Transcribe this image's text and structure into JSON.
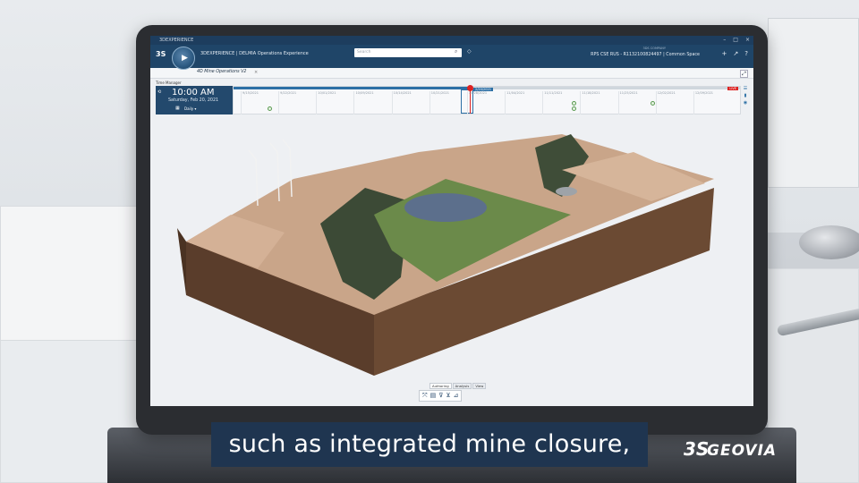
{
  "app": {
    "window_title": "3DEXPERIENCE",
    "brand_title": "3DEXPERIENCE | DELMIA Operations Experience",
    "search_placeholder": "Search",
    "user_caption": "3DS COMPANY",
    "user_context": "RPS  CSE RUS - R1132100824497 | Common Space",
    "tab_label": "4D Mine Operations V2",
    "tab_close": "×",
    "panel_label": "Time Manager"
  },
  "clock": {
    "time": "10:00 AM",
    "date": "Saturday, Feb 20, 2021",
    "mode": "Daily"
  },
  "timeline": {
    "ticks": [
      "9/15/2021",
      "9/22/2021",
      "10/01/2021",
      "10/09/2021",
      "10/14/2021",
      "10/21/2021",
      "10/28/2021",
      "11/04/2021",
      "11/11/2021",
      "11/18/2021",
      "11/25/2021",
      "12/02/2021",
      "12/09/2021"
    ],
    "current_label": "2/20/2021",
    "live_label": "LIVE"
  },
  "toolbar": {
    "tabs": [
      "Authoring",
      "Analysis",
      "View"
    ]
  },
  "subtitle": "such as integrated mine closure,",
  "logo": {
    "ds": "3S",
    "name": "GEOVIA"
  },
  "colors": {
    "app_header": "#1f4568",
    "clock_panel": "#23496d",
    "accent_red": "#dd2222",
    "subtitle_bg": "#1f3550"
  }
}
